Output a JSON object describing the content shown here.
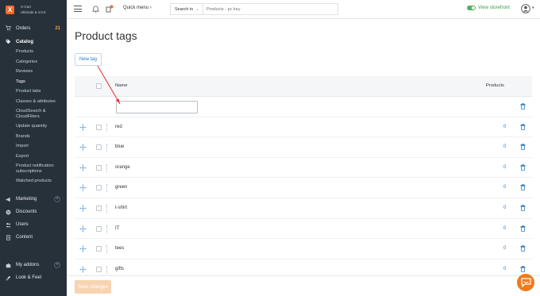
{
  "brand": {
    "logo_letter": "X",
    "name": "X-Cart",
    "edition": "Ultimate 5.4.0.5"
  },
  "sidebar": {
    "orders": {
      "label": "Orders",
      "badge": "21"
    },
    "catalog": {
      "label": "Catalog",
      "items": [
        "Products",
        "Categories",
        "Reviews",
        "Tags",
        "Product tabs",
        "Classes & attributes",
        "CloudSearch & CloudFilters",
        "Update quantity",
        "Brands",
        "Import",
        "Export",
        "Product notification subscriptions",
        "Watched products"
      ]
    },
    "marketing": "Marketing",
    "discounts": "Discounts",
    "users": "Users",
    "content": "Content",
    "my_addons": "My addons",
    "look_feel": "Look & Feel"
  },
  "topbar": {
    "quick_menu": "Quick menu",
    "search_in": "Search in",
    "search_placeholder": "Products - pc key",
    "view_storefront": "View storefront"
  },
  "page": {
    "title": "Product tags",
    "new_tag_button": "New tag",
    "save_button": "Save changes"
  },
  "table": {
    "col_name": "Name",
    "col_products": "Products",
    "new_row_value": "",
    "rows": [
      {
        "name": "red",
        "products": "0"
      },
      {
        "name": "blue",
        "products": "0"
      },
      {
        "name": "orange",
        "products": "0"
      },
      {
        "name": "green",
        "products": "0"
      },
      {
        "name": "t-shirt",
        "products": "0"
      },
      {
        "name": "IT",
        "products": "0"
      },
      {
        "name": "tees",
        "products": "0"
      },
      {
        "name": "gifts",
        "products": "0"
      }
    ]
  },
  "colors": {
    "sidebar_bg": "#27313a",
    "accent_orange": "#f06b2b",
    "link_blue": "#2d7bc3",
    "storefront_green": "#3c9a4f",
    "annotation_red": "#e03030"
  }
}
